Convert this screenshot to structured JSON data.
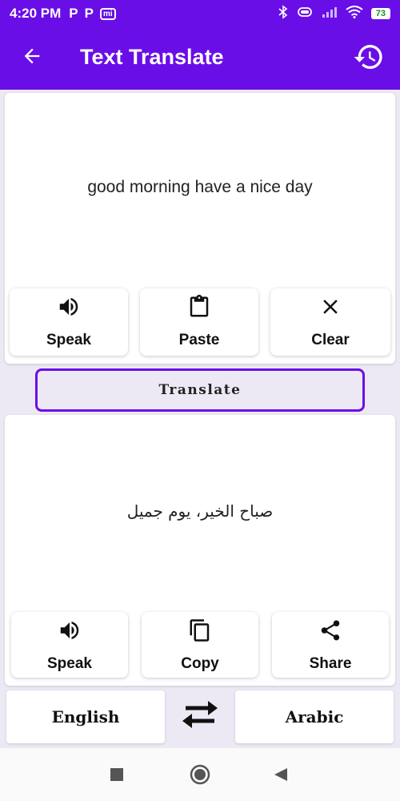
{
  "status_bar": {
    "time": "4:20 PM",
    "notif_icons": [
      "P",
      "P"
    ],
    "mi_badge": "mi",
    "battery": "73"
  },
  "app_bar": {
    "title": "Text Translate"
  },
  "input": {
    "text": "good morning have a nice day",
    "actions": {
      "speak": "Speak",
      "paste": "Paste",
      "clear": "Clear"
    }
  },
  "translate_button": "Translate",
  "output": {
    "text": "صباح الخير، يوم جميل",
    "actions": {
      "speak": "Speak",
      "copy": "Copy",
      "share": "Share"
    }
  },
  "languages": {
    "source": "English",
    "target": "Arabic"
  },
  "colors": {
    "primary": "#6a0ee8",
    "background": "#ede9f4"
  }
}
